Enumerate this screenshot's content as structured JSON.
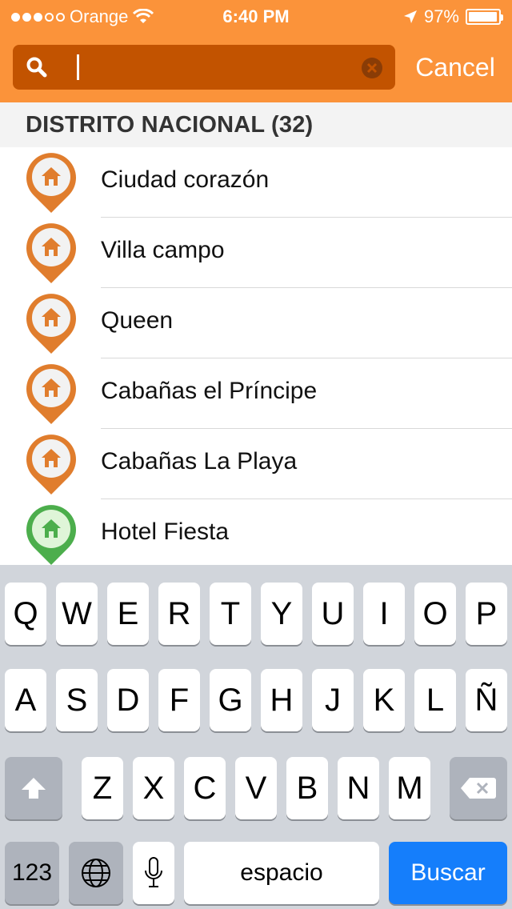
{
  "status_bar": {
    "carrier": "Orange",
    "time": "6:40 PM",
    "battery": "97%",
    "battery_level": 0.97,
    "signal_bars": 3,
    "icons": [
      "wifi-icon",
      "location-arrow-icon",
      "battery-icon"
    ]
  },
  "search": {
    "value": "",
    "cancel_label": "Cancel"
  },
  "section": {
    "title": "DISTRITO NACIONAL (32)"
  },
  "list": [
    {
      "name": "Ciudad corazón",
      "pin_color": "#e07d2d"
    },
    {
      "name": "Villa campo",
      "pin_color": "#e07d2d"
    },
    {
      "name": "Queen",
      "pin_color": "#e07d2d"
    },
    {
      "name": "Cabañas el Príncipe",
      "pin_color": "#e07d2d"
    },
    {
      "name": "Cabañas La Playa",
      "pin_color": "#e07d2d"
    },
    {
      "name": "Hotel Fiesta",
      "pin_color": "#4cae4c"
    }
  ],
  "keyboard": {
    "row1": [
      "Q",
      "W",
      "E",
      "R",
      "T",
      "Y",
      "U",
      "I",
      "O",
      "P"
    ],
    "row2": [
      "A",
      "S",
      "D",
      "F",
      "G",
      "H",
      "J",
      "K",
      "L",
      "Ñ"
    ],
    "row3": [
      "Z",
      "X",
      "C",
      "V",
      "B",
      "N",
      "M"
    ],
    "numbers_label": "123",
    "space_label": "espacio",
    "action_label": "Buscar"
  },
  "colors": {
    "header": "#fb933a",
    "search_field": "#c25300",
    "action_key": "#157efb"
  }
}
